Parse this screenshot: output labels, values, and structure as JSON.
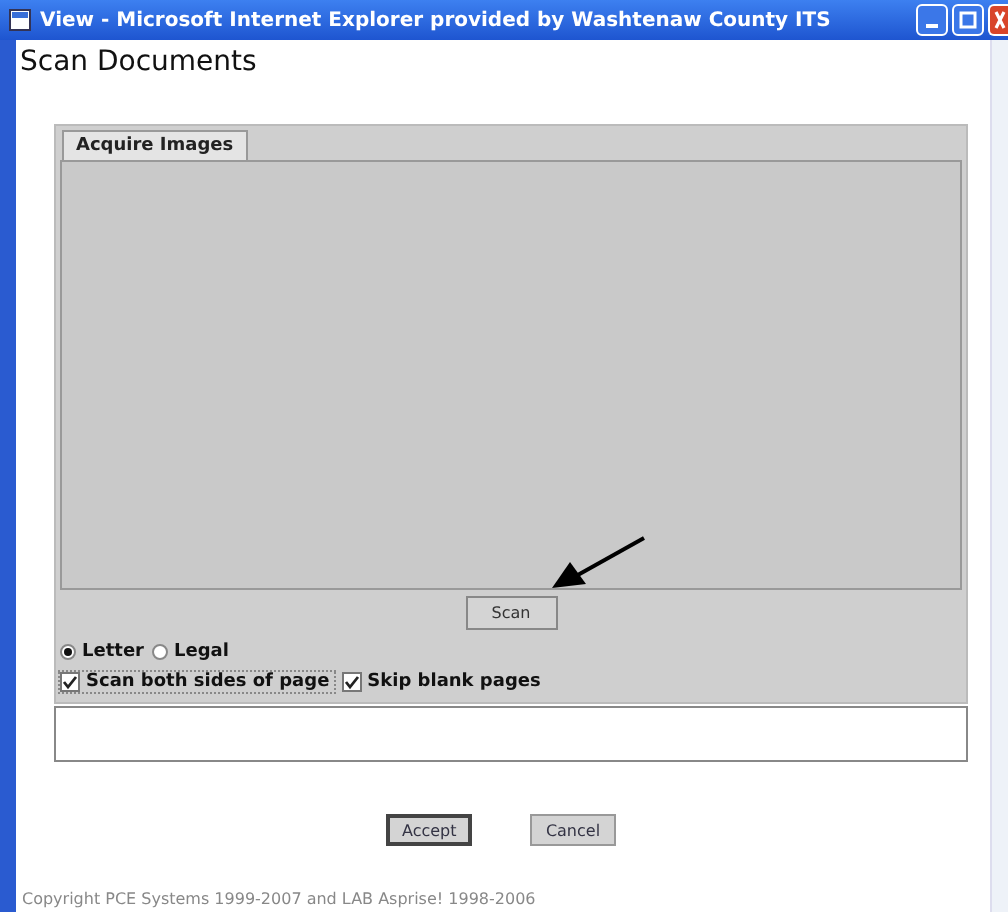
{
  "window": {
    "title": "View - Microsoft Internet Explorer provided by Washtenaw County ITS"
  },
  "heading": "Scan Documents",
  "tabs": [
    {
      "label": "Acquire Images",
      "selected": true
    }
  ],
  "scan_button": "Scan",
  "paper_sizes": [
    {
      "label": "Letter",
      "selected": true
    },
    {
      "label": "Legal",
      "selected": false
    }
  ],
  "options": [
    {
      "label": "Scan both sides of page",
      "checked": true
    },
    {
      "label": "Skip blank pages",
      "checked": true
    }
  ],
  "buttons": [
    "Accept",
    "Cancel"
  ],
  "copyright": "Copyright PCE Systems 1999-2007 and LAB Asprise! 1998-2006"
}
